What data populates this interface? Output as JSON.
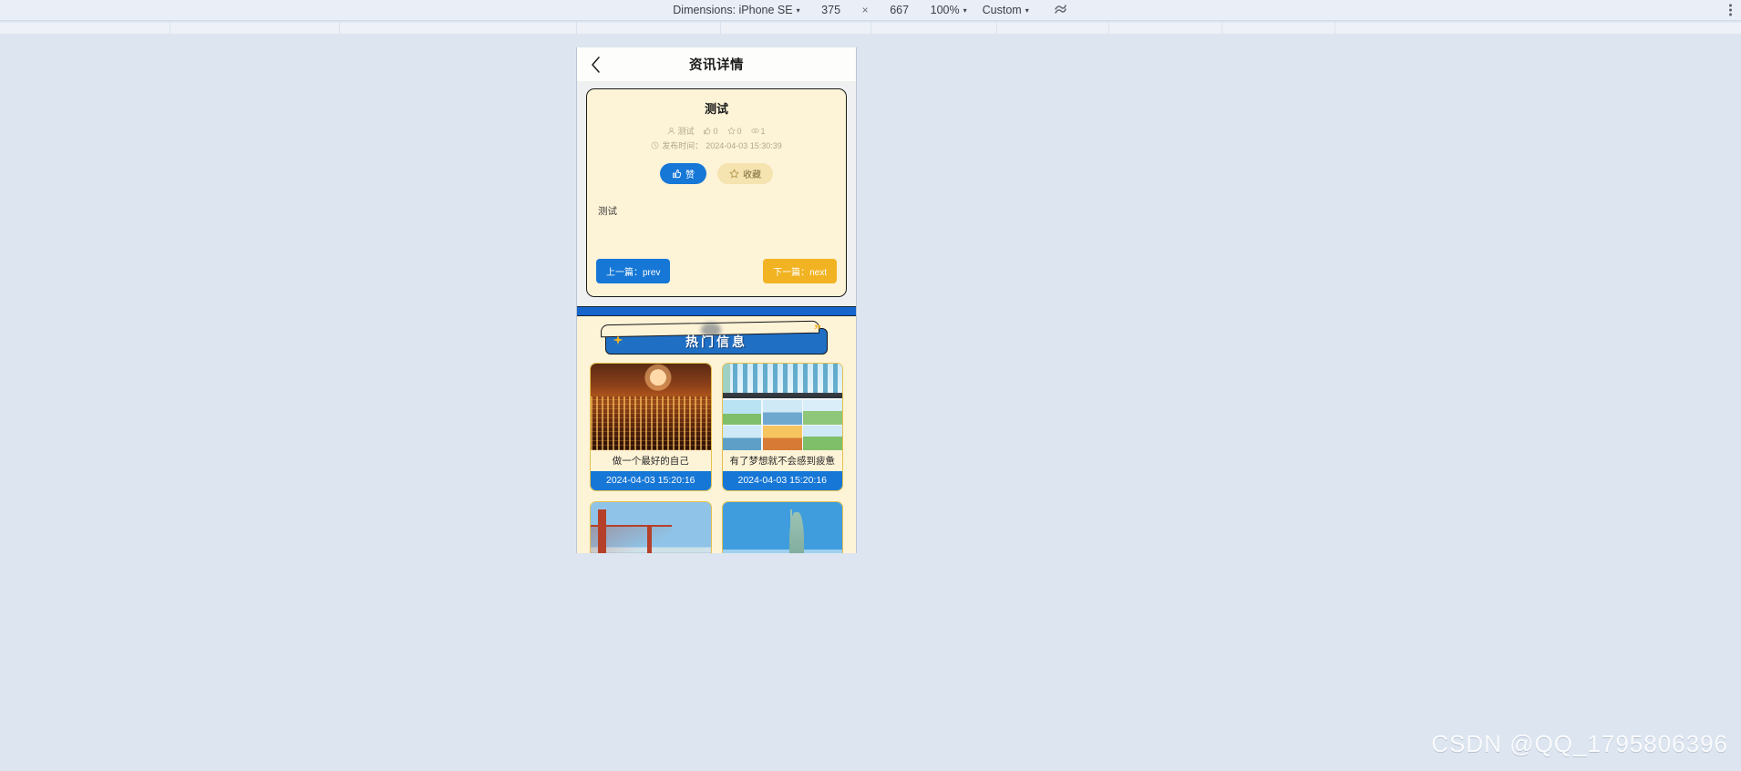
{
  "devtools": {
    "dimensions_label": "Dimensions: iPhone SE",
    "width_value": "375",
    "times_symbol": "×",
    "height_value": "667",
    "zoom_value": "100%",
    "throttle_value": "Custom",
    "throttle_icon": "network-throttle-icon",
    "more_icon": "kebab-menu-icon",
    "caret": "▾"
  },
  "app": {
    "nav": {
      "back_icon": "chevron-left-icon",
      "title": "资讯详情"
    },
    "article": {
      "title": "测试",
      "author_icon": "user-icon",
      "author": "测试",
      "like_icon": "thumb-up-icon",
      "like_count": "0",
      "star_icon": "star-outline-icon",
      "star_count": "0",
      "view_icon": "eye-icon",
      "view_count": "1",
      "time_icon": "clock-icon",
      "publish_label": "发布时间：",
      "publish_time": "2024-04-03 15:30:39",
      "like_button": "赞",
      "fav_button": "收藏",
      "body": "测试",
      "prev_button": "上一篇：prev",
      "next_button": "下一篇：next"
    },
    "hot": {
      "banner_title": "热门信息",
      "spark_icon": "sparkle-icon",
      "quote_icon": "quote-mark-icon",
      "cards": [
        {
          "title": "做一个最好的自己",
          "date": "2024-04-03 15:20:16",
          "art": "art-night",
          "image_name": "city-night-skyline-photo"
        },
        {
          "title": "有了梦想就不会感到疲惫",
          "date": "2024-04-03 15:20:16",
          "art": "art-city",
          "image_name": "city-illustration-collage"
        },
        {
          "title": "",
          "date": "",
          "art": "art-bridge",
          "image_name": "golden-gate-bridge-photo"
        },
        {
          "title": "",
          "date": "",
          "art": "art-liberty",
          "image_name": "statue-of-liberty-photo"
        }
      ]
    }
  },
  "watermark": "CSDN @QQ_1795806396",
  "colors": {
    "primary_blue": "#1677d6",
    "banner_blue": "#1f6fc4",
    "accent_yellow": "#f2b322",
    "card_cream": "#fdf3d7",
    "page_bg": "#dde5f0"
  }
}
